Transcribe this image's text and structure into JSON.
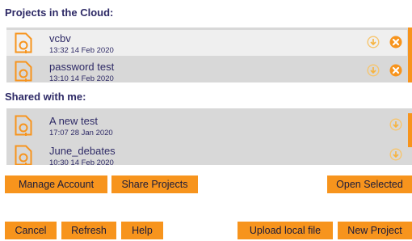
{
  "cloud_section": {
    "title": "Projects in the Cloud:",
    "items": [
      {
        "name": "vcbv",
        "date": "13:32  14 Feb 2020"
      },
      {
        "name": "password test",
        "date": "13:10  14 Feb 2020"
      }
    ]
  },
  "shared_section": {
    "title": "Shared with me:",
    "items": [
      {
        "name": "A new test",
        "date": "17:07  28 Jan 2020"
      },
      {
        "name": "June_debates",
        "date": "10:30  14 Feb 2020"
      }
    ]
  },
  "buttons": {
    "manage_account": "Manage Account",
    "share_projects": "Share Projects",
    "open_selected": "Open Selected",
    "cancel": "Cancel",
    "refresh": "Refresh",
    "help": "Help",
    "upload_local_file": "Upload local file",
    "new_project": "New Project"
  },
  "icons": {
    "file": "document-icon",
    "download": "download-icon",
    "delete": "delete-icon"
  },
  "colors": {
    "accent": "#f7941d",
    "text": "#2e2a66",
    "panel": "#d8d8d8",
    "selected_row": "#efefef"
  }
}
